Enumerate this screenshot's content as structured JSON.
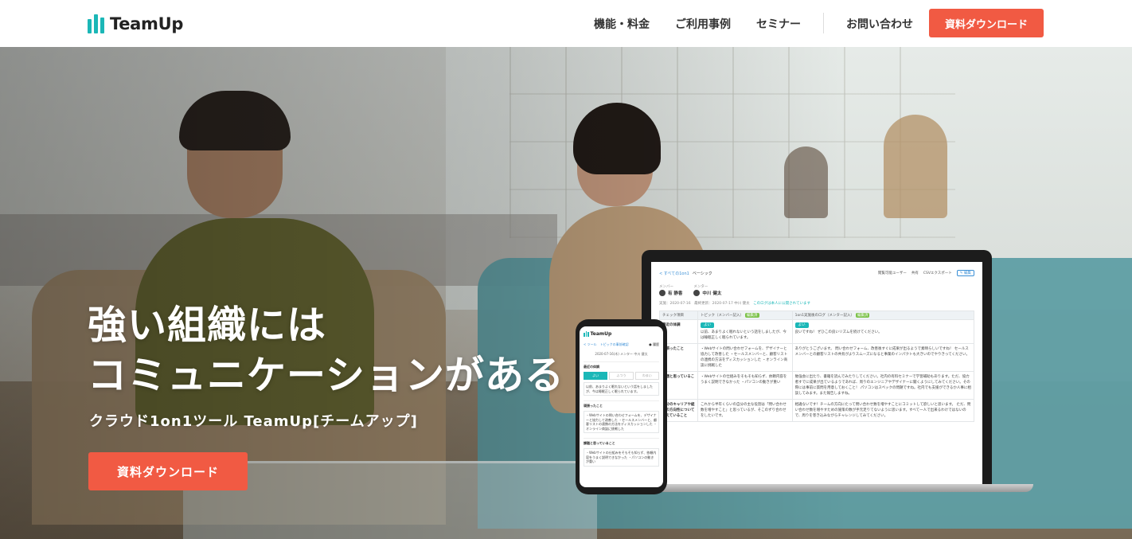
{
  "header": {
    "logo_text": "TeamUp",
    "nav": [
      "機能・料金",
      "ご利用事例",
      "セミナー",
      "お問い合わせ"
    ],
    "cta_label": "資料ダウンロード"
  },
  "hero": {
    "title_line1": "強い組織には",
    "title_line2": "コミュニケーションがある",
    "subtitle": "クラウド1on1ツール TeamUp[チームアップ]",
    "cta_label": "資料ダウンロード"
  },
  "laptop_screen": {
    "breadcrumb_link": "< すべての1on1",
    "breadcrumb_current": "ベーシック",
    "viewers_label": "閲覧可能ユーザー",
    "share_label": "共有",
    "csv_label": "CSVエクスポート",
    "edit_label": "✎ 編集",
    "member_label": "メンバー",
    "member_name": "有 静香",
    "mentor_label": "メンター",
    "mentor_name": "中川 健太",
    "dates": "実施：2020-07-16　最終更新：2020-07-17 中川 健太",
    "notice": "このログは本人に公開されています",
    "columns": [
      "チェック項目",
      "トピック（メンバー記入）",
      "1on1実施後のログ（メンター記入）"
    ],
    "badge": "編集済",
    "tag": "よい",
    "rows": [
      {
        "head": "最近の体調",
        "topic": "以前、あまりよく眠れないという話をしましたが、今は睡眠正しく眠られています。",
        "log": "良いですね！ ぜひこの良いリズムを続けてください。"
      },
      {
        "head": "頑張ったこと",
        "topic": "・Webサイトの問い合わせフォームを、デザイナーと協力して改善した ・セールスメンバーと、顧客リストの連携の方法をディスカッションした ・オンライン商談に挑戦した",
        "log": "ありがとうございます。 問い合わせフォーム、改善後すぐに成果が出るようで素晴らしいですね！ セールスメンバーとの顧客リストの共有がよりスムーズになると事業のインパクトも大きいのでやりきってください。"
      },
      {
        "head": "課題と思っていること",
        "topic": "・Webサイトの仕組みをそもそも知らず、依頼内容をうまく説明できなかった ・パソコンの動きが重い",
        "log": "勉強会に出たり、書籍を読んでみたりしてください。社内の有料セミナーで学習補助もあります。ただ、協力者すでに成果が出ているようであれば、周りのエンジニアやデザイナーに聞くようにしてみてください。その際には事前に質問を用意しておくこと！ パソコンはスペックの問題ですね。社内でも支援ができるか人事に相談してみます。また報告しますね。"
      },
      {
        "head": "自分のキャリアや組織の方向性について考えていること",
        "topic": "これから半年くらいの自分の主な役割は「問い合わせ数を増やすこと」と思っているが、そこのずり合わせをしたいです。",
        "log": "相違ないです！チームの方向にたって問い合わせ数を増やすことにコミットして欲しいと思います。 ただ、問い合わせ数を増やすための施策の数が手元足りてないように思います。すべて一人で出来るわけではないので、周りを巻き込みながらチャレンジしてみてください。"
      }
    ]
  },
  "phone_screen": {
    "logo_text": "TeamUp",
    "breadcrumb": "< ツール　トピックの事前確認",
    "menu": "● 履歴",
    "date": "2020-07-16(木) メンター 中川 健太",
    "sec1": "最近の体調",
    "tabs": [
      "よい",
      "ふつう",
      "わるい"
    ],
    "box1": "以前、あまりよく眠れないという話をしましたが、今は睡眠正しく眠られています。",
    "sec2": "頑張ったこと",
    "box2": "・Webサイトの問い合わせフォームを、デザイナーと協力して改善した ・セールスメンバーと、顧客リストの連携の方法をディスカッションした ・オンライン商談に挑戦した",
    "sec3": "課題と思っていること",
    "box3": "・Webサイトの仕組みをそもそも知らず、依頼内容をうまく説明できなかった ・パソコンの動きが重い"
  },
  "colors": {
    "accent": "#f15a43",
    "brand": "#1bb7b7"
  }
}
